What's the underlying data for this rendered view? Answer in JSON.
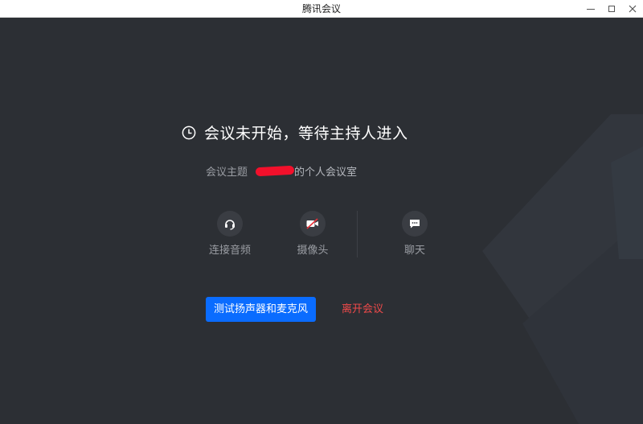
{
  "window": {
    "title": "腾讯会议",
    "controls": [
      "minimize-icon",
      "maximize-icon",
      "close-icon"
    ]
  },
  "meeting": {
    "status_text": "会议未开始，等待主持人进入",
    "subject_label": "会议主题",
    "subject_value": "的个人会议室"
  },
  "controls": {
    "audio_label": "连接音频",
    "camera_label": "摄像头",
    "chat_label": "聊天"
  },
  "actions": {
    "test_button": "测试扬声器和麦克风",
    "leave_button": "离开会议"
  },
  "colors": {
    "background": "#2c2f34",
    "primary_button": "#0a6cff",
    "leave_text": "#f04a4a",
    "redaction": "#f2102b"
  }
}
